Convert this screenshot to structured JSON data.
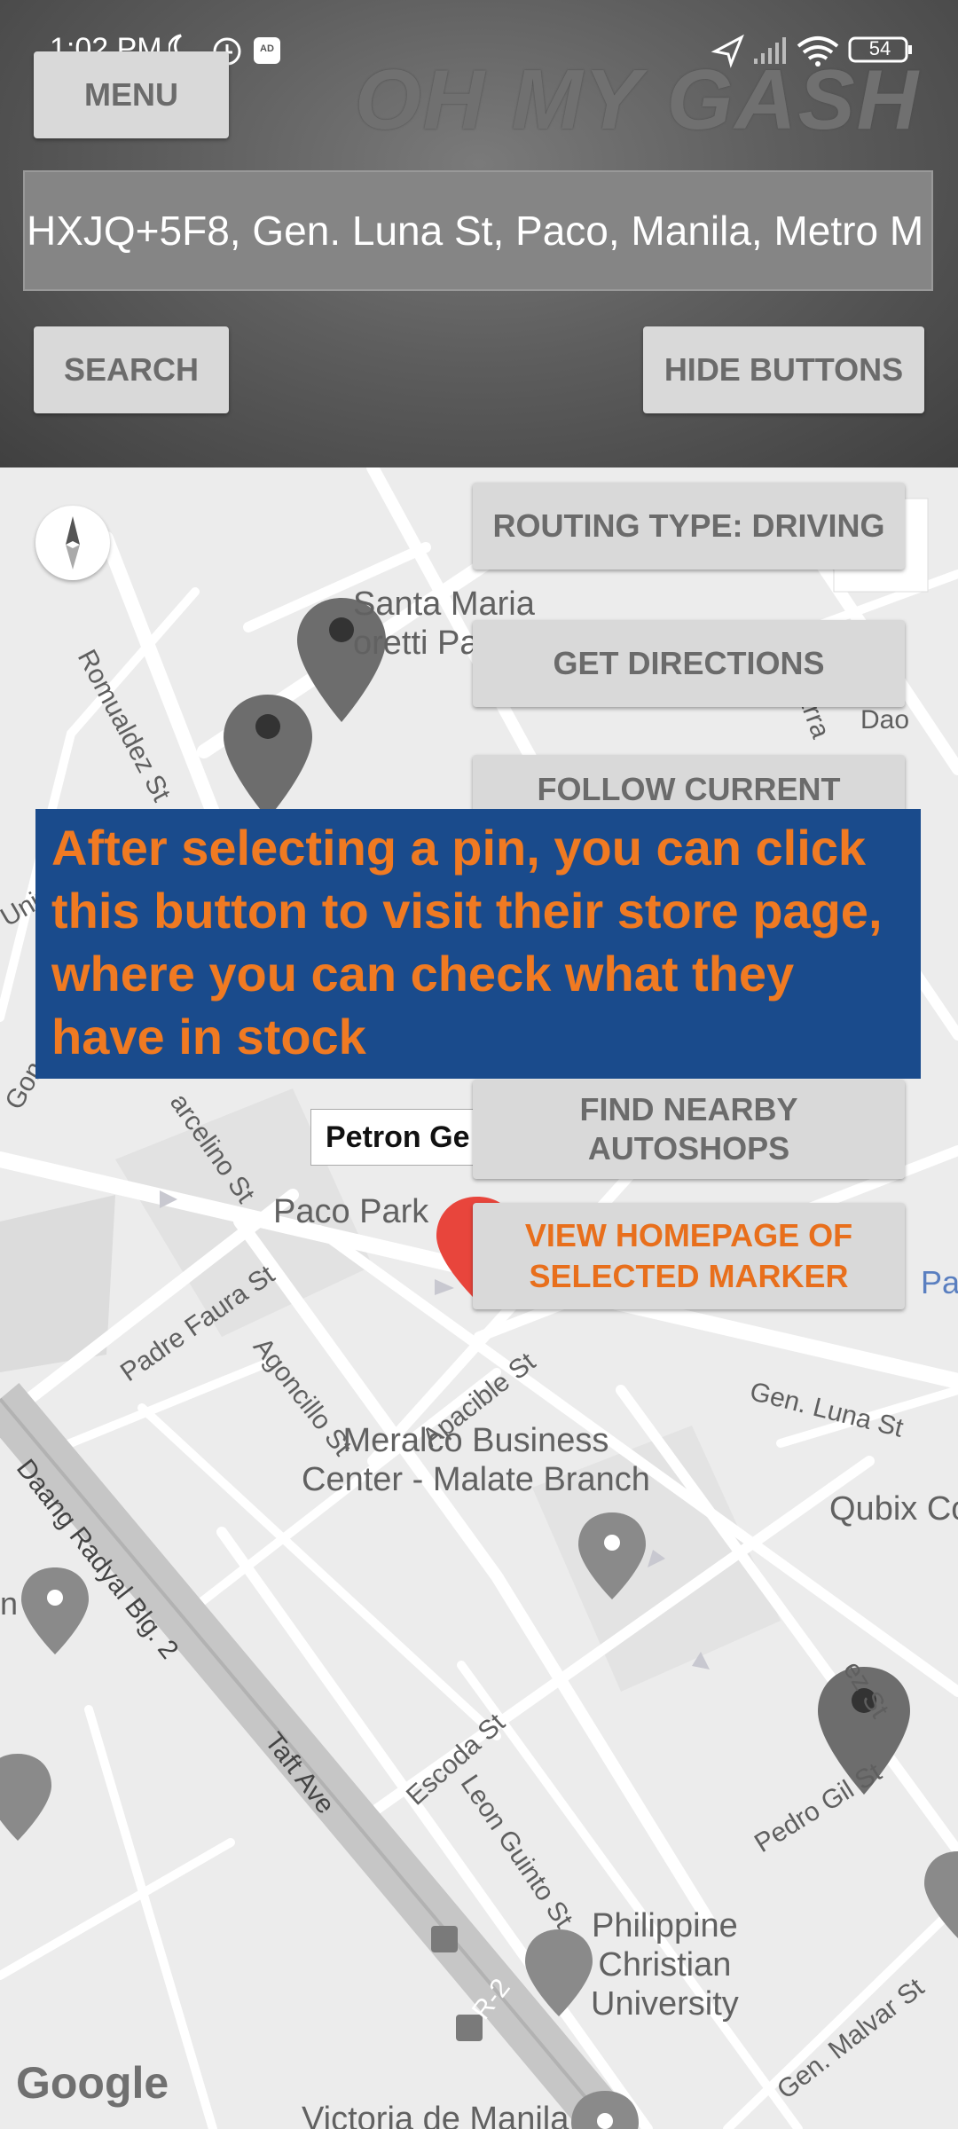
{
  "status_bar": {
    "time": "1:02 PM",
    "battery": "54"
  },
  "app": {
    "title": "OH MY GASH"
  },
  "header": {
    "menu_label": "MENU",
    "search_value": "HXJQ+5F8, Gen. Luna St, Paco, Manila, Metro M",
    "search_label": "SEARCH",
    "hide_buttons_label": "HIDE BUTTONS"
  },
  "map_buttons": {
    "routing_type": "ROUTING TYPE: DRIVING",
    "get_directions": "GET DIRECTIONS",
    "follow_current": "FOLLOW CURRENT",
    "find_nearby_line1": "FIND NEARBY",
    "find_nearby_line2": "AUTOSHOPS",
    "view_homepage_line1": "VIEW HOMEPAGE OF",
    "view_homepage_line2": "SELECTED MARKER"
  },
  "tooltip": {
    "text": "After selecting a pin, you can click this button to visit their store page, where you can check what they have in stock"
  },
  "marker_callout": {
    "label": "Petron Ge"
  },
  "map_labels": {
    "santa_maria_line1": "Santa Maria",
    "santa_maria_line2": "oretti Pa",
    "romualdez": "Romualdez St",
    "paco_park": "Paco Park",
    "padre_faura": "Padre Faura St",
    "agoncillo": "Agoncillo St",
    "apacible": "Apacible St",
    "gen_luna": "Gen. Luna St",
    "marcelino": "arcelino St",
    "meralco_line1": "Meralco Business",
    "meralco_line2": "Center - Malate Branch",
    "qubix": "Qubix Co",
    "daang_radyal": "Daang Radyal Blg. 2",
    "taft": "Taft Ave",
    "escoda": "Escoda St",
    "leon_guinto": "Leon Guinto St",
    "pedro_gil": "Pedro Gil St",
    "pcu_line1": "Philippine",
    "pcu_line2": "Christian",
    "pcu_line3": "University",
    "gen_malvar": "Gen. Malvar St",
    "victoria": "Victoria de Manila",
    "dao": "Dao",
    "arra": "arra",
    "unit": "Unit",
    "gon": "Gon",
    "pa": "Pa",
    "n_frag": "n",
    "ez_st": "ez St",
    "r2": "R-2",
    "google": "Google"
  },
  "colors": {
    "header_dark": "#404040",
    "button_bg": "#d9d9d9",
    "button_text": "#6b6b6b",
    "tooltip_bg": "#1a4b8c",
    "tooltip_text": "#f07a22",
    "selected_marker": "#e8453c",
    "marker": "#6d6d6d"
  }
}
